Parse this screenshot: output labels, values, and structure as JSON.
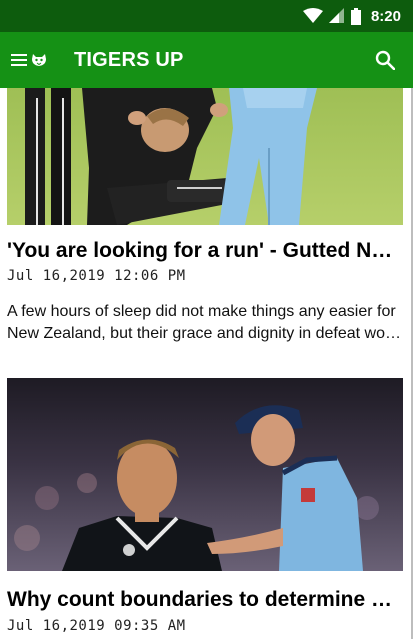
{
  "status_bar": {
    "time": "8:20",
    "icons": [
      "wifi-icon",
      "cellular-signal-icon",
      "battery-icon"
    ]
  },
  "app_bar": {
    "title": "TIGERS UP",
    "icons": [
      "menu-icon",
      "tiger-logo-icon",
      "search-icon"
    ],
    "background": "#159115",
    "status_background": "#0d5c0d"
  },
  "articles": [
    {
      "headline": "'You are looking for a run' - Gutted New Zealand players reflect on World Cup final heartbreak",
      "timestamp": "Jul 16,2019 12:06 PM",
      "excerpt": "A few hours of sleep did not make things any easier for New Zealand, but their grace and dignity in defeat won them admirers all over the world"
    },
    {
      "headline": "Why count boundaries to determine who wins the World Cup?",
      "timestamp": "Jul 16,2019 09:35 AM",
      "excerpt": ""
    }
  ]
}
